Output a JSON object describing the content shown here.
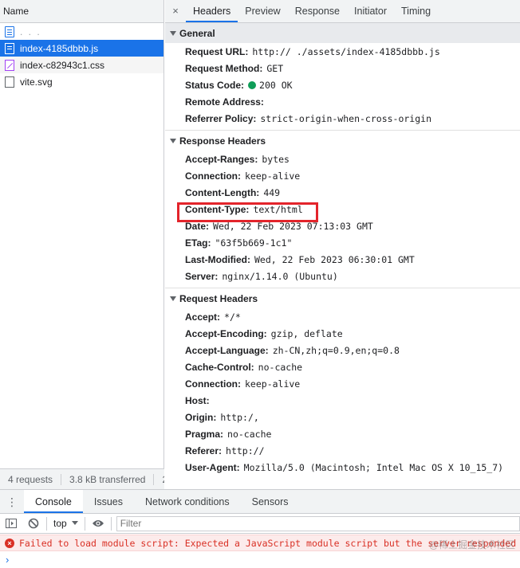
{
  "left_panel": {
    "header": "Name",
    "files": [
      {
        "name": ". . .",
        "icon": "document-icon",
        "state": "normal"
      },
      {
        "name": "index-4185dbbb.js",
        "icon": "script-icon",
        "state": "selected"
      },
      {
        "name": "index-c82943c1.css",
        "icon": "stylesheet-icon",
        "state": "alt"
      },
      {
        "name": "vite.svg",
        "icon": "image-icon",
        "state": "normal"
      }
    ],
    "footer": {
      "requests": "4 requests",
      "transferred": "3.8 kB transferred",
      "extra": "2"
    }
  },
  "detail_tabs": {
    "close": "×",
    "tabs": [
      "Headers",
      "Preview",
      "Response",
      "Initiator",
      "Timing"
    ],
    "active": "Headers"
  },
  "general": {
    "title": "General",
    "rows": [
      {
        "key": "Request URL:",
        "value": "http://                       ./assets/index-4185dbbb.js"
      },
      {
        "key": "Request Method:",
        "value": "GET"
      },
      {
        "key": "Status Code:",
        "value": "200 OK",
        "status_color": "#0f9d58"
      },
      {
        "key": "Remote Address:",
        "value": ""
      },
      {
        "key": "Referrer Policy:",
        "value": "strict-origin-when-cross-origin"
      }
    ]
  },
  "response_headers": {
    "title": "Response Headers",
    "rows": [
      {
        "key": "Accept-Ranges:",
        "value": "bytes"
      },
      {
        "key": "Connection:",
        "value": "keep-alive"
      },
      {
        "key": "Content-Length:",
        "value": "449"
      },
      {
        "key": "Content-Type:",
        "value": "text/html"
      },
      {
        "key": "Date:",
        "value": "Wed, 22 Feb 2023 07:13:03 GMT"
      },
      {
        "key": "ETag:",
        "value": "\"63f5b669-1c1\""
      },
      {
        "key": "Last-Modified:",
        "value": "Wed, 22 Feb 2023 06:30:01 GMT"
      },
      {
        "key": "Server:",
        "value": "nginx/1.14.0 (Ubuntu)"
      }
    ]
  },
  "request_headers": {
    "title": "Request Headers",
    "rows": [
      {
        "key": "Accept:",
        "value": "*/*"
      },
      {
        "key": "Accept-Encoding:",
        "value": "gzip, deflate"
      },
      {
        "key": "Accept-Language:",
        "value": "zh-CN,zh;q=0.9,en;q=0.8"
      },
      {
        "key": "Cache-Control:",
        "value": "no-cache"
      },
      {
        "key": "Connection:",
        "value": "keep-alive"
      },
      {
        "key": "Host:",
        "value": ""
      },
      {
        "key": "Origin:",
        "value": "http:/,"
      },
      {
        "key": "Pragma:",
        "value": "no-cache"
      },
      {
        "key": "Referer:",
        "value": "http://"
      },
      {
        "key": "User-Agent:",
        "value": "Mozilla/5.0 (Macintosh; Intel Mac OS X 10_15_7)"
      }
    ]
  },
  "drawer": {
    "menu_icon": "⋮",
    "tabs": [
      "Console",
      "Issues",
      "Network conditions",
      "Sensors"
    ],
    "active": "Console",
    "context": "top",
    "filter_placeholder": "Filter"
  },
  "console": {
    "error_icon": "×",
    "error_message": "Failed to load module script: Expected a JavaScript module script but the server responded",
    "prompt": "›",
    "watermark": "@稀土掘金技术社区"
  },
  "colors": {
    "accent": "#1a73e8",
    "error": "#d93025",
    "status_ok": "#0f9d58",
    "highlight": "#e3242b"
  }
}
